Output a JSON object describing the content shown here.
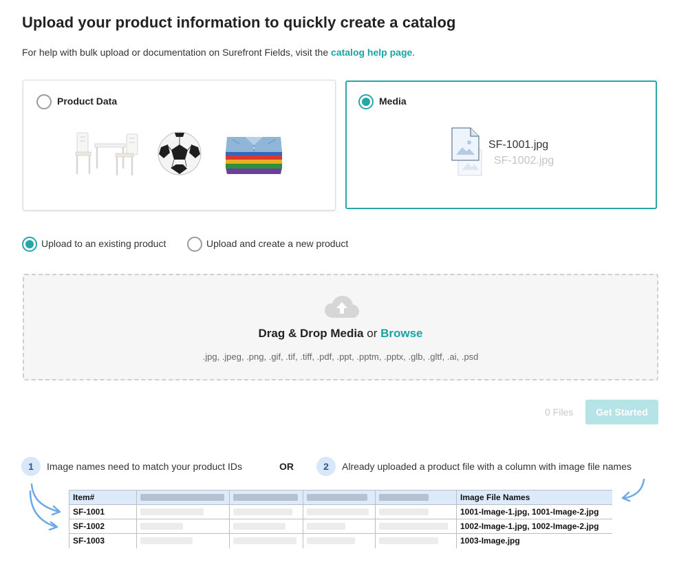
{
  "header": {
    "title": "Upload your product information to quickly create a catalog",
    "help_prefix": "For help with bulk upload or documentation on Surefront Fields, visit the ",
    "help_link": "catalog help page",
    "help_suffix": "."
  },
  "options": {
    "product_data": {
      "label": "Product Data",
      "selected": false
    },
    "media": {
      "label": "Media",
      "selected": true,
      "file_primary": "SF-1001.jpg",
      "file_secondary": "SF-1002.jpg"
    }
  },
  "upload_mode": {
    "existing_label": "Upload to an existing product",
    "new_label": "Upload and create a new product",
    "selected": "existing"
  },
  "dropzone": {
    "title_bold": "Drag & Drop Media",
    "title_or": " or ",
    "browse": "Browse",
    "formats": ".jpg, .jpeg, .png, .gif, .tif, .tiff, .pdf, .ppt, .pptm, .pptx, .glb, .gltf, .ai, .psd"
  },
  "footer": {
    "files_count": "0 Files",
    "get_started": "Get Started"
  },
  "instructions": {
    "step1_number": "1",
    "step1_text": "Image names need to match your product IDs",
    "or": "OR",
    "step2_number": "2",
    "step2_text": "Already uploaded a product file with a column with image file names"
  },
  "example_table": {
    "headers": [
      "Item#",
      "Image File Names"
    ],
    "rows": [
      {
        "item": "SF-1001",
        "images": "1001-Image-1.jpg, 1001-Image-2.jpg"
      },
      {
        "item": "SF-1002",
        "images": "1002-Image-1.jpg, 1002-Image-2.jpg"
      },
      {
        "item": "SF-1003",
        "images": "1003-Image.jpg"
      }
    ]
  },
  "colors": {
    "accent": "#26a6a6",
    "link": "#1aa3a3",
    "button_disabled": "#b6e3e6",
    "step_bg": "#d8e8f8",
    "table_header_bg": "#dcebfb",
    "arrow": "#6aa8e8"
  },
  "icons": [
    "radio-icon",
    "chair-table-icon",
    "soccer-ball-icon",
    "folded-shirts-icon",
    "image-file-icon",
    "cloud-upload-icon",
    "curved-arrow-icon"
  ]
}
